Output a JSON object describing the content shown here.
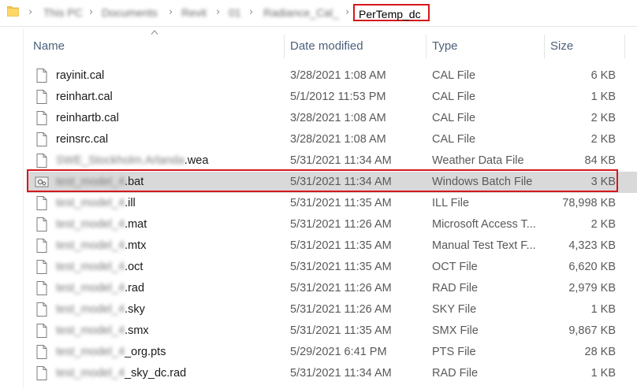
{
  "breadcrumb": {
    "items": [
      "This PC",
      "Documents",
      "Revit",
      "01",
      "Radiance_Cal_"
    ],
    "current": "PerTemp_dc"
  },
  "columns": {
    "name": "Name",
    "date": "Date modified",
    "type": "Type",
    "size": "Size"
  },
  "files": [
    {
      "prefix": "",
      "suffix": "rayinit.cal",
      "date": "3/28/2021 1:08 AM",
      "type": "CAL File",
      "size": "6 KB",
      "icon": "document-icon"
    },
    {
      "prefix": "",
      "suffix": "reinhart.cal",
      "date": "5/1/2012 11:53 PM",
      "type": "CAL File",
      "size": "1 KB",
      "icon": "document-icon"
    },
    {
      "prefix": "",
      "suffix": "reinhartb.cal",
      "date": "3/28/2021 1:08 AM",
      "type": "CAL File",
      "size": "2 KB",
      "icon": "document-icon"
    },
    {
      "prefix": "",
      "suffix": "reinsrc.cal",
      "date": "3/28/2021 1:08 AM",
      "type": "CAL File",
      "size": "2 KB",
      "icon": "document-icon"
    },
    {
      "prefix": "SWE_Stockholm.Arlanda",
      "suffix": ".wea",
      "date": "5/31/2021 11:34 AM",
      "type": "Weather Data File",
      "size": "84 KB",
      "icon": "document-icon"
    },
    {
      "prefix": "test_model_4",
      "suffix": ".bat",
      "date": "5/31/2021 11:34 AM",
      "type": "Windows Batch File",
      "size": "3 KB",
      "icon": "batch-file-icon",
      "selected": true
    },
    {
      "prefix": "test_model_4",
      "suffix": ".ill",
      "date": "5/31/2021 11:35 AM",
      "type": "ILL File",
      "size": "78,998 KB",
      "icon": "document-icon"
    },
    {
      "prefix": "test_model_4",
      "suffix": ".mat",
      "date": "5/31/2021 11:26 AM",
      "type": "Microsoft Access T...",
      "size": "2 KB",
      "icon": "document-icon"
    },
    {
      "prefix": "test_model_4",
      "suffix": ".mtx",
      "date": "5/31/2021 11:35 AM",
      "type": "Manual Test Text F...",
      "size": "4,323 KB",
      "icon": "document-icon"
    },
    {
      "prefix": "test_model_4",
      "suffix": ".oct",
      "date": "5/31/2021 11:35 AM",
      "type": "OCT File",
      "size": "6,620 KB",
      "icon": "document-icon"
    },
    {
      "prefix": "test_model_4",
      "suffix": ".rad",
      "date": "5/31/2021 11:26 AM",
      "type": "RAD File",
      "size": "2,979 KB",
      "icon": "document-icon"
    },
    {
      "prefix": "test_model_4",
      "suffix": ".sky",
      "date": "5/31/2021 11:26 AM",
      "type": "SKY File",
      "size": "1 KB",
      "icon": "document-icon"
    },
    {
      "prefix": "test_model_4",
      "suffix": ".smx",
      "date": "5/31/2021 11:35 AM",
      "type": "SMX File",
      "size": "9,867 KB",
      "icon": "document-icon"
    },
    {
      "prefix": "test_model_4",
      "suffix": "_org.pts",
      "date": "5/29/2021 6:41 PM",
      "type": "PTS File",
      "size": "28 KB",
      "icon": "document-icon"
    },
    {
      "prefix": "test_model_4",
      "suffix": "_sky_dc.rad",
      "date": "5/31/2021 11:34 AM",
      "type": "RAD File",
      "size": "1 KB",
      "icon": "document-icon"
    }
  ],
  "colors": {
    "highlight_outline": "#d6171c",
    "selected_row": "#d9d9d9",
    "header_text": "#4c607a"
  }
}
